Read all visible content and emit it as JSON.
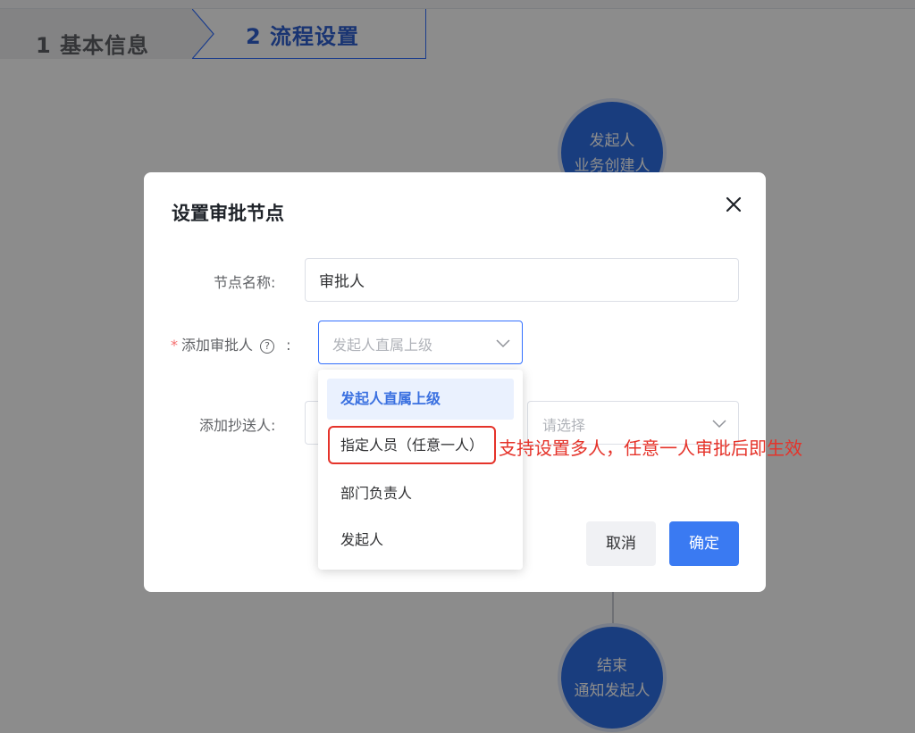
{
  "steps": [
    {
      "label": "1 基本信息"
    },
    {
      "label": "2 流程设置"
    }
  ],
  "flow": {
    "start_node": {
      "title": "发起人",
      "subtitle": "业务创建人"
    },
    "end_node": {
      "title": "结束",
      "subtitle": "通知发起人"
    }
  },
  "dialog": {
    "title": "设置审批节点",
    "fields": {
      "node_name": {
        "label": "节点名称:",
        "value": "审批人"
      },
      "approver": {
        "required_mark": "*",
        "label": "添加审批人",
        "help_icon": "?",
        "colon": ":",
        "placeholder": "发起人直属上级"
      },
      "cc": {
        "label": "添加抄送人:",
        "placeholder": "请选择"
      }
    },
    "buttons": {
      "cancel": "取消",
      "confirm": "确定"
    }
  },
  "dropdown": {
    "options": [
      {
        "label": "发起人直属上级",
        "selected": true
      },
      {
        "label": "指定人员（任意一人）",
        "selected": false
      },
      {
        "label": "部门负责人",
        "selected": false
      },
      {
        "label": "发起人",
        "selected": false
      }
    ]
  },
  "annotation": {
    "text": "支持设置多人，任意一人审批后即生效",
    "color": "#e5332a"
  },
  "colors": {
    "primary": "#3a7af2",
    "node": "#2e6fe6",
    "danger": "#f56c6c"
  }
}
